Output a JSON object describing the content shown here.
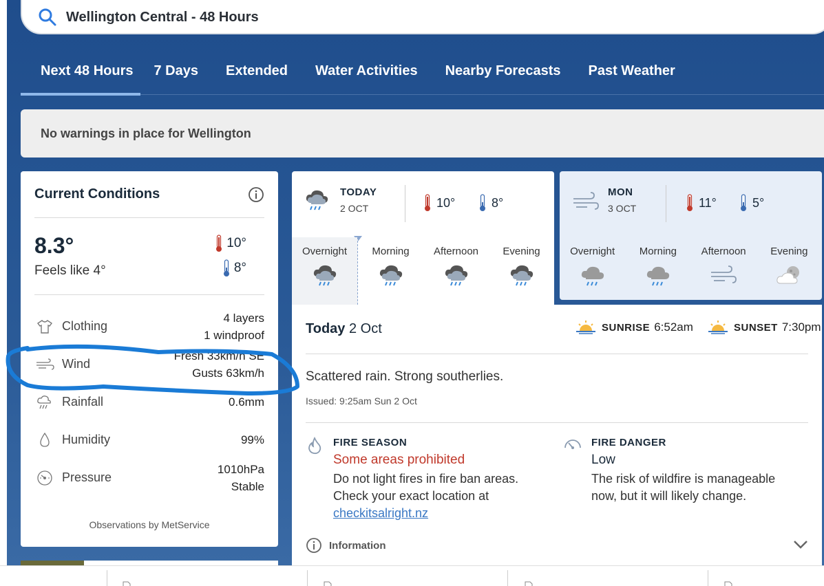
{
  "search": {
    "query": "Wellington Central - 48 Hours"
  },
  "tabs": [
    {
      "label": "Next 48 Hours",
      "active": true
    },
    {
      "label": "7 Days"
    },
    {
      "label": "Extended"
    },
    {
      "label": "Water Activities"
    },
    {
      "label": "Nearby Forecasts"
    },
    {
      "label": "Past Weather"
    }
  ],
  "warning": "No warnings in place for Wellington",
  "current": {
    "title": "Current Conditions",
    "temp": "8.3°",
    "feels": "Feels like 4°",
    "high": "10°",
    "low": "8°",
    "rows": [
      {
        "label": "Clothing",
        "value1": "4 layers",
        "value2": "1 windproof"
      },
      {
        "label": "Wind",
        "value1": "Fresh 33km/h SE",
        "value2": "Gusts 63km/h"
      },
      {
        "label": "Rainfall",
        "value1": "0.6mm"
      },
      {
        "label": "Humidity",
        "value1": "99%"
      },
      {
        "label": "Pressure",
        "value1": "1010hPa",
        "value2": "Stable"
      }
    ],
    "footer": "Observations by MetService"
  },
  "days": [
    {
      "name": "TODAY",
      "date": "2 OCT",
      "high": "10°",
      "low": "8°",
      "periods": [
        "Overnight",
        "Morning",
        "Afternoon",
        "Evening"
      ]
    },
    {
      "name": "MON",
      "date": "3 OCT",
      "high": "11°",
      "low": "5°",
      "periods": [
        "Overnight",
        "Morning",
        "Afternoon",
        "Evening"
      ]
    }
  ],
  "detail": {
    "title_bold": "Today",
    "title_rest": " 2 Oct",
    "sunrise_label": "SUNRISE",
    "sunrise": "6:52am",
    "sunset_label": "SUNSET",
    "sunset": "7:30pm",
    "summary": "Scattered rain. Strong southerlies.",
    "issued": "Issued: 9:25am Sun 2 Oct",
    "fire_season": {
      "title": "FIRE SEASON",
      "value": "Some areas prohibited",
      "text1": "Do not light fires in fire ban areas.",
      "text2": "Check your exact location at",
      "link": "checkitsalright.nz"
    },
    "fire_danger": {
      "title": "FIRE DANGER",
      "value": "Low",
      "text1": "The risk of wildfire is manageable",
      "text2": "now, but it will likely change."
    },
    "info": "Information"
  },
  "colors": {
    "accent": "#1f4d8c",
    "fire_red": "#c0392b",
    "link": "#3a78c4",
    "annotation": "#1a7bd6"
  }
}
